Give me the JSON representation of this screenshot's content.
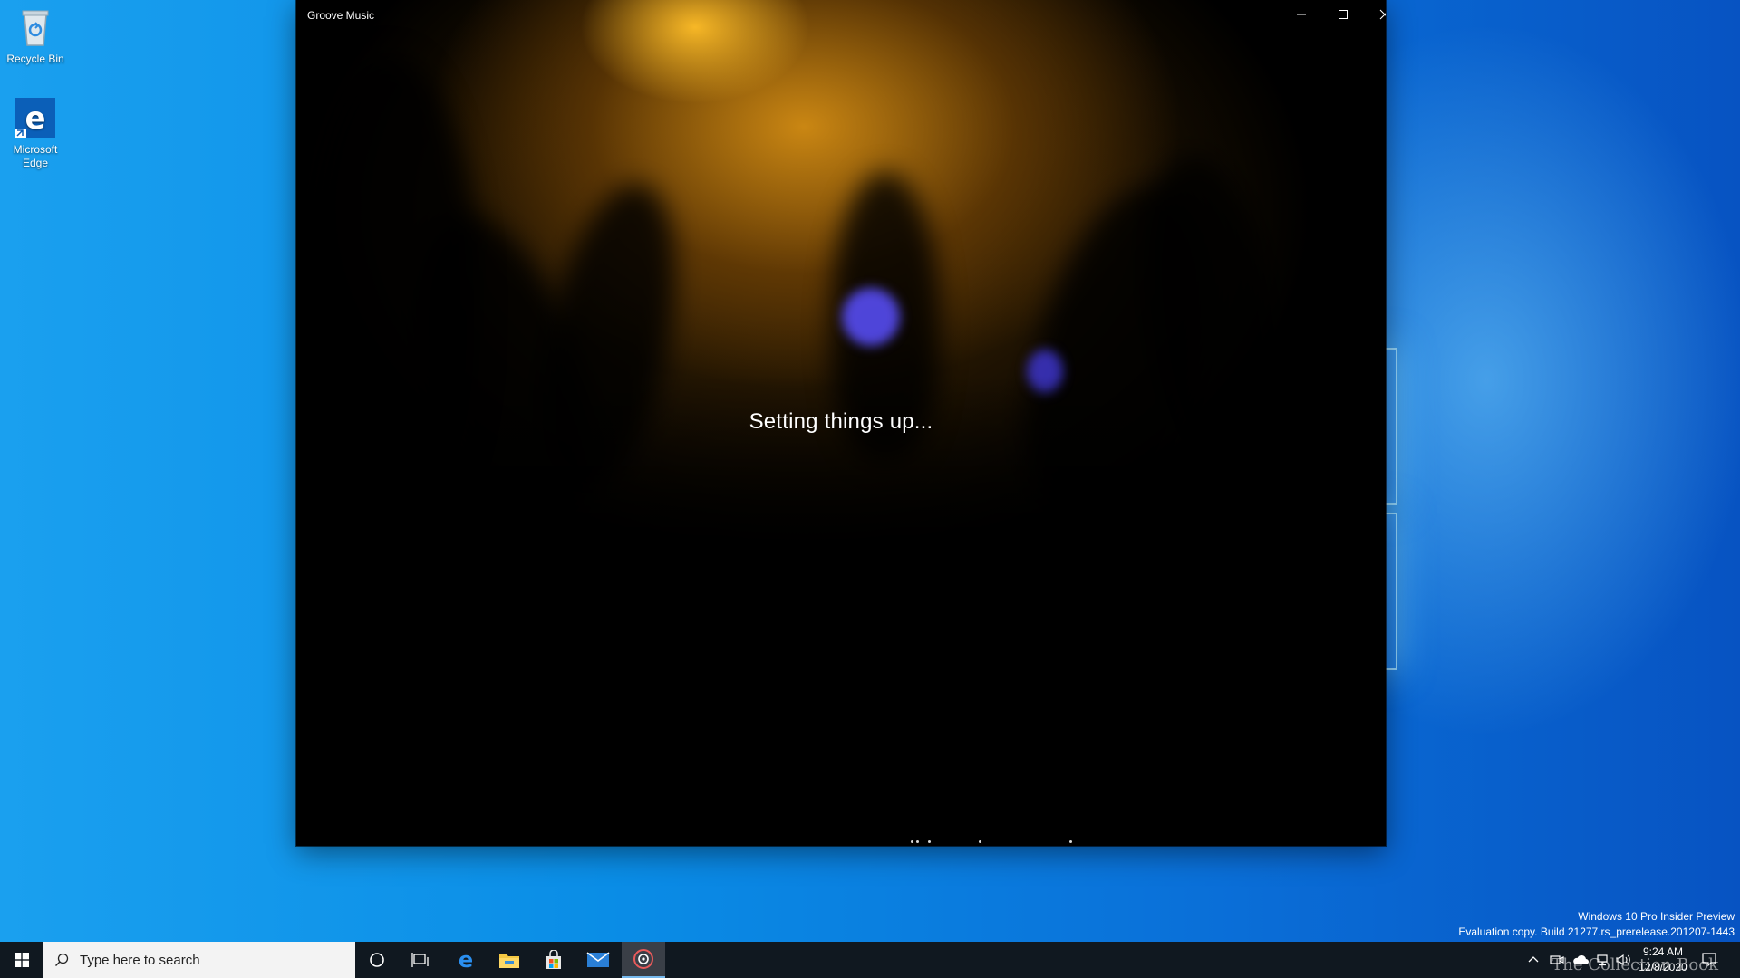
{
  "desktop": {
    "icons": [
      {
        "label": "Recycle Bin",
        "icon": "recycle-bin-icon"
      },
      {
        "label": "Microsoft Edge",
        "icon": "edge-icon"
      }
    ],
    "watermark": {
      "line1": "Windows 10 Pro Insider Preview",
      "line2": "Evaluation copy. Build 21277.rs_prerelease.201207-1443"
    }
  },
  "window": {
    "title": "Groove Music",
    "minimize_icon": "minimize-icon",
    "maximize_icon": "maximize-icon",
    "close_icon": "close-icon",
    "status": "Setting things up..."
  },
  "taskbar": {
    "search_placeholder": "Type here to search",
    "pinned": [
      "cortana-icon",
      "task-view-icon",
      "edge-icon",
      "file-explorer-icon",
      "store-icon",
      "mail-icon",
      "groove-music-icon"
    ],
    "active_app": "groove-music-icon",
    "clock": {
      "time": "9:24 AM",
      "date": "12/8/2020"
    },
    "brand_overlay": "The Collection Book"
  },
  "colors": {
    "accent": "#0078d7",
    "taskbar": "#101820",
    "window_bg": "#000000"
  }
}
